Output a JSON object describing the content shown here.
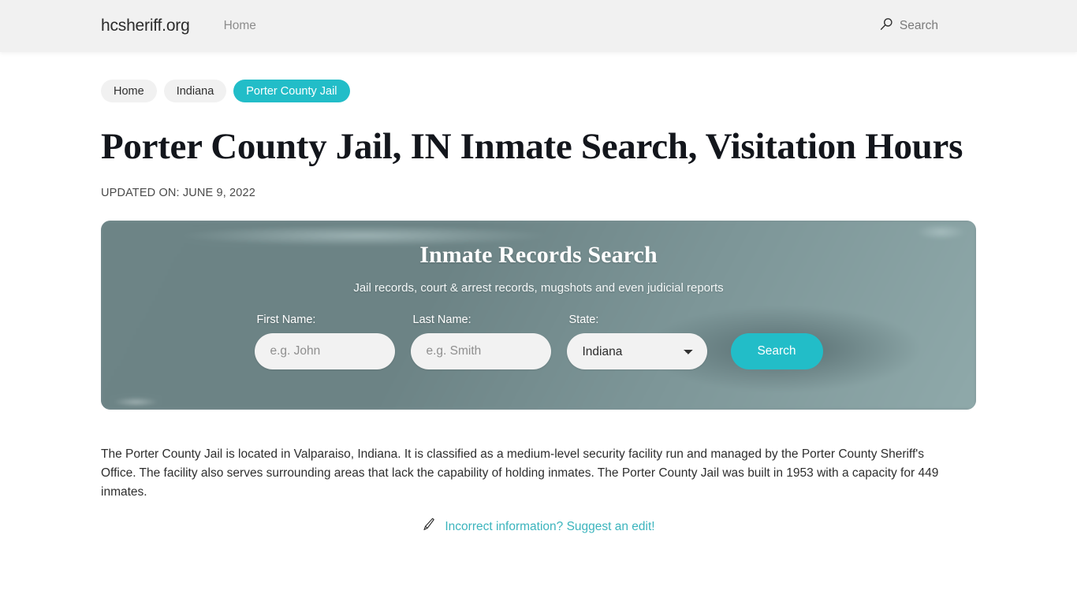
{
  "header": {
    "brand": "hcsheriff.org",
    "nav": [
      {
        "label": "Home"
      }
    ],
    "search": {
      "label": "Search",
      "icon": "search-icon"
    }
  },
  "breadcrumbs": [
    {
      "label": "Home",
      "active": false
    },
    {
      "label": "Indiana",
      "active": false
    },
    {
      "label": "Porter County Jail",
      "active": true
    }
  ],
  "main": {
    "title": "Porter County Jail, IN Inmate Search, Visitation Hours",
    "updated": "UPDATED ON: JUNE 9, 2022",
    "body": "The Porter County Jail is located in Valparaiso, Indiana. It is classified as a medium-level security facility run and managed by the Porter County Sheriff's Office. The facility also serves surrounding areas that lack the capability of holding inmates. The Porter County Jail was built in 1953 with a capacity for 449 inmates."
  },
  "search_card": {
    "title": "Inmate Records Search",
    "subtitle": "Jail records, court & arrest records, mugshots and even judicial reports",
    "first_name": {
      "label": "First Name:",
      "placeholder": "e.g. John",
      "value": ""
    },
    "last_name": {
      "label": "Last Name:",
      "placeholder": "e.g. Smith",
      "value": ""
    },
    "state": {
      "label": "State:",
      "selected": "Indiana",
      "options": [
        "Indiana"
      ]
    },
    "submit_label": "Search"
  },
  "suggest_edit": {
    "icon": "pencil-icon",
    "label": "Incorrect information? Suggest an edit!"
  },
  "colors": {
    "accent_teal": "#22bdc8",
    "link_teal": "#3bb4bd",
    "header_bg": "#f1f1f1",
    "pill_bg": "#f1f1f1",
    "card_base": "#6d8486",
    "title": "#13161c"
  }
}
